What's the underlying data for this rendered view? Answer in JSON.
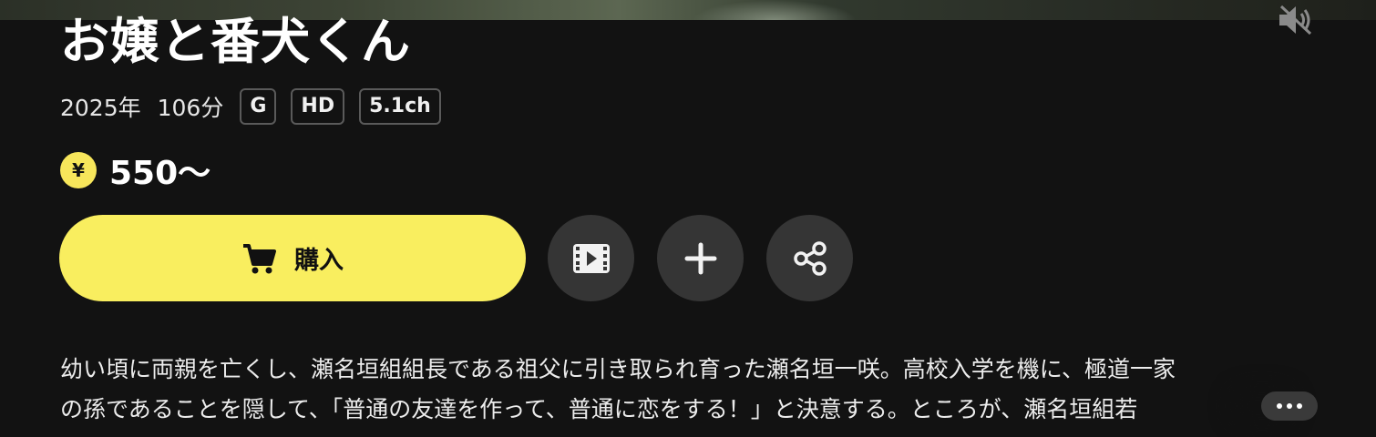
{
  "title": "お嬢と番犬くん",
  "meta": {
    "year": "2025年",
    "duration": "106分",
    "badges": [
      "G",
      "HD",
      "5.1ch"
    ]
  },
  "price": {
    "currency_symbol": "¥",
    "amount": "550〜"
  },
  "actions": {
    "buy_label": "購入",
    "trailer_icon": "film-play-icon",
    "add_icon": "plus-icon",
    "share_icon": "share-icon"
  },
  "description": {
    "line1": "幼い頃に両親を亡くし、瀬名垣組組長である祖父に引き取られ育った瀬名垣一咲。高校入学を機に、極道一家",
    "line2": "の孫であることを隠して、「普通の友達を作って、普通に恋をする！」と決意する。ところが、瀬名垣組若"
  },
  "icons": {
    "mute": "speaker-muted-icon",
    "more": "more-dots-icon"
  },
  "colors": {
    "background": "#121212",
    "accent": "#f9ee5f",
    "circle_button": "#353535"
  }
}
